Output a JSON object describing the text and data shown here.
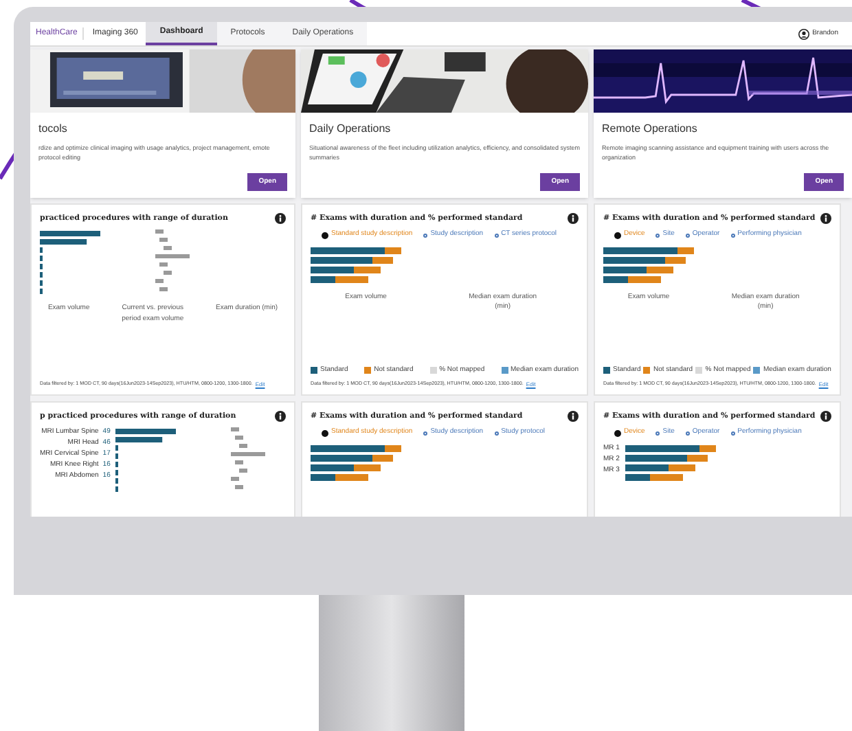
{
  "nav": {
    "brand": "HealthCare",
    "app": "Imaging 360",
    "tabs": [
      {
        "label": "Dashboard",
        "selected": true
      },
      {
        "label": "Protocols",
        "selected": false
      },
      {
        "label": "Daily Operations",
        "selected": false
      }
    ],
    "user": "Brandon"
  },
  "cards": [
    {
      "title": "tocols",
      "description": "rdize and optimize clinical imaging with usage analytics, project management, emote protocol editing",
      "button": "Open"
    },
    {
      "title": "Daily Operations",
      "description": "Situational awareness of the fleet including utilization analytics, efficiency, and consolidated system summaries",
      "button": "Open"
    },
    {
      "title": "Remote Operations",
      "description": "Remote imaging scanning assistance and equipment training with users across the organization",
      "button": "Open"
    }
  ],
  "panels": [
    {
      "kind": "range",
      "title": "practiced procedures with range of duration",
      "axis_labels": [
        "Exam volume",
        "Current vs. previous period exam volume",
        "Exam duration (min)"
      ],
      "footer": "Data filtered by: 1 MOD CT, 90 days(16Jun2023-14Sep2023), HTU/HTM, 0800-1200, 1300-1800.",
      "link": "Edit"
    },
    {
      "kind": "standard",
      "title": "# Exams with duration and % performed standard",
      "legend": [
        {
          "label": "Standard study description",
          "selected": true
        },
        {
          "label": "Study description",
          "selected": false
        },
        {
          "label": "CT series protocol",
          "selected": false
        }
      ],
      "axis_labels": [
        "Exam volume",
        "Median exam duration (min)"
      ],
      "key": [
        "Standard",
        "Not standard",
        "% Not mapped",
        "Median exam duration"
      ],
      "footer": "Data filtered by: 1 MOD CT, 90 days(16Jun2023-14Sep2023), HTU/HTM, 0800-1200, 1300-1800.",
      "link": "Edit"
    },
    {
      "kind": "standard",
      "title": "# Exams with duration and % performed standard",
      "legend": [
        {
          "label": "Device",
          "selected": true
        },
        {
          "label": "Site",
          "selected": false
        },
        {
          "label": "Operator",
          "selected": false
        },
        {
          "label": "Performing physician",
          "selected": false
        }
      ],
      "axis_labels": [
        "Exam volume",
        "Median exam duration (min)"
      ],
      "key": [
        "Standard",
        "Not standard",
        "% Not mapped",
        "Median exam duration"
      ],
      "footer": "Data filtered by: 1 MOD CT, 90 days(16Jun2023-14Sep2023), HTU/HTM, 0800-1200, 1300-1800.",
      "link": "Edit"
    },
    {
      "kind": "range",
      "title": "p practiced procedures with range of duration",
      "rows": [
        {
          "label": "MRI Lumbar Spine",
          "value": "49"
        },
        {
          "label": "MRI Head",
          "value": "46"
        },
        {
          "label": "MRI Cervical Spine",
          "value": "17"
        },
        {
          "label": "MRI Knee Right",
          "value": "16"
        },
        {
          "label": "MRI Abdomen",
          "value": "16"
        }
      ]
    },
    {
      "kind": "standard",
      "title": "# Exams with duration and % performed standard",
      "legend": [
        {
          "label": "Standard study description",
          "selected": true
        },
        {
          "label": "Study description",
          "selected": false
        },
        {
          "label": "Study protocol",
          "selected": false
        }
      ]
    },
    {
      "kind": "standard",
      "title": "# Exams with duration and % performed standard",
      "legend": [
        {
          "label": "Device",
          "selected": true
        },
        {
          "label": "Site",
          "selected": false
        },
        {
          "label": "Operator",
          "selected": false
        },
        {
          "label": "Performing physician",
          "selected": false
        }
      ],
      "rows": [
        {
          "label": "MR 1"
        },
        {
          "label": "MR 2"
        },
        {
          "label": "MR 3"
        }
      ]
    }
  ]
}
